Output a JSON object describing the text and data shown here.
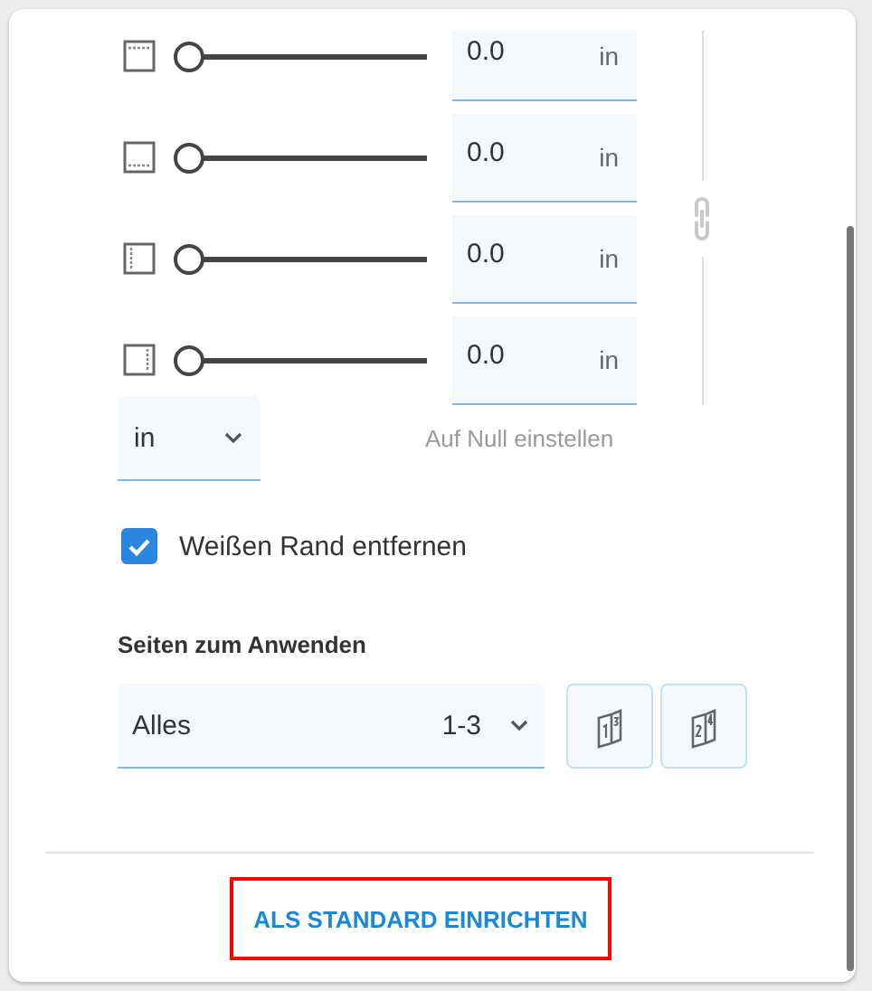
{
  "margins": [
    {
      "kind": "top",
      "level": 0,
      "value": "0.0",
      "unit": "in"
    },
    {
      "kind": "bottom",
      "level": 0,
      "value": "0.0",
      "unit": "in"
    },
    {
      "kind": "left",
      "level": 0,
      "value": "0.0",
      "unit": "in"
    },
    {
      "kind": "right",
      "level": 0,
      "value": "0.0",
      "unit": "in"
    }
  ],
  "unit_select": {
    "value": "in"
  },
  "reset_link": {
    "label": "Auf Null einstellen",
    "disabled": true
  },
  "checkbox": {
    "label": "Weißen Rand entfernen",
    "checked": true
  },
  "pages": {
    "label": "Seiten zum Anwenden",
    "value": "Alles",
    "range": "1-3",
    "buttons": [
      {
        "kind": "odd"
      },
      {
        "kind": "even"
      }
    ]
  },
  "default_button": {
    "label": "ALS STANDARD EINRICHTEN",
    "highlighted": true
  }
}
